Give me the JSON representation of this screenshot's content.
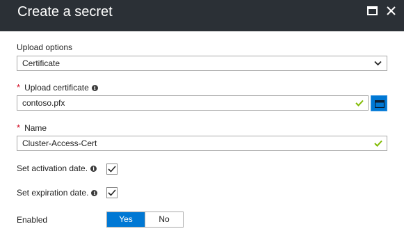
{
  "header": {
    "title": "Create a secret",
    "maximize_icon": "maximize-icon",
    "close_icon": "close-icon",
    "background": "#2b3036"
  },
  "upload_options": {
    "label": "Upload options",
    "selected": "Certificate"
  },
  "upload_certificate": {
    "required_marker": "*",
    "label": "Upload certificate",
    "value": "contoso.pfx",
    "valid": true,
    "browse_icon": "folder-icon"
  },
  "name": {
    "required_marker": "*",
    "label": "Name",
    "value": "Cluster-Access-Cert",
    "valid": true
  },
  "activation": {
    "label": "Set activation date.",
    "checked": true
  },
  "expiration": {
    "label": "Set expiration date.",
    "checked": true
  },
  "enabled": {
    "label": "Enabled",
    "options": [
      "Yes",
      "No"
    ],
    "selected": "Yes"
  },
  "colors": {
    "accent": "#0078d4",
    "valid_check": "#7fba00",
    "required": "#d0021b"
  }
}
